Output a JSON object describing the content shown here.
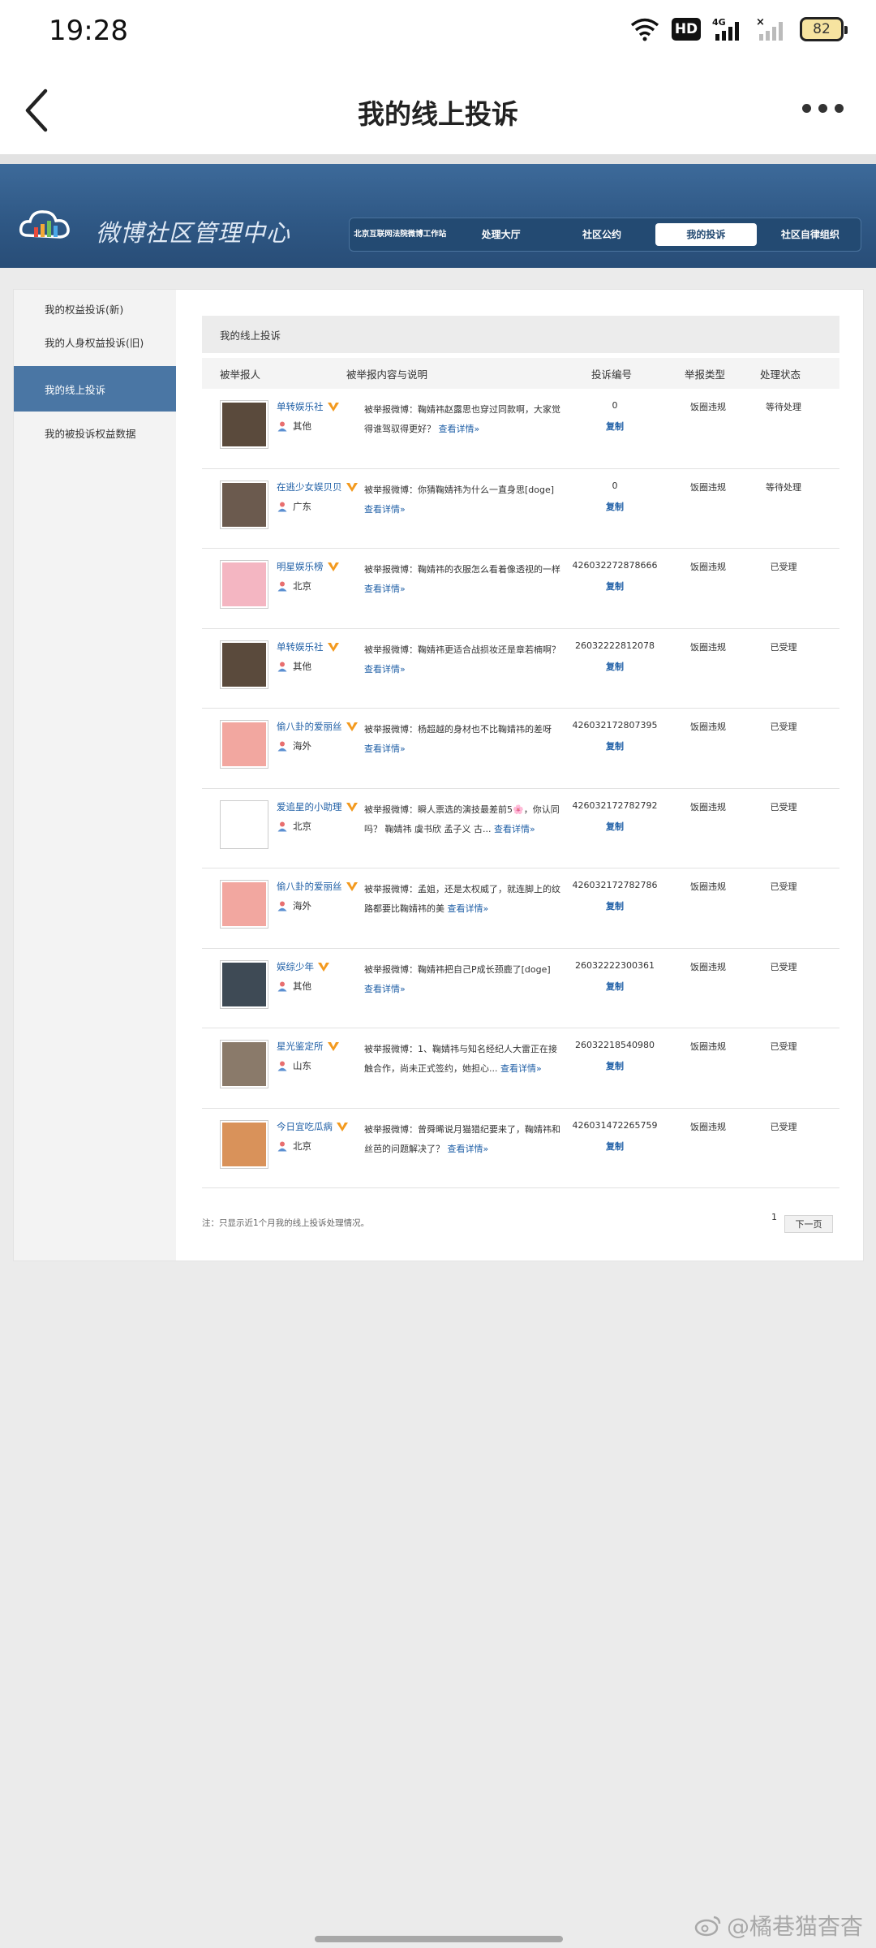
{
  "status_bar": {
    "time": "19:28",
    "hd_label": "HD",
    "network_label": "4G",
    "battery": "82",
    "icons": [
      "wifi-icon",
      "hd-icon",
      "signal-icon",
      "signal-muted-icon",
      "battery-icon"
    ]
  },
  "app_header": {
    "title": "我的线上投诉",
    "back_icon": "chevron-left-icon",
    "more_icon": "more-horizontal-icon"
  },
  "banner": {
    "title": "微博社区管理中心",
    "logo_icon": "cloud-logo-icon",
    "nav": [
      {
        "label": "北京互联网法院微博工作站",
        "active": false
      },
      {
        "label": "处理大厅",
        "active": false
      },
      {
        "label": "社区公约",
        "active": false
      },
      {
        "label": "我的投诉",
        "active": true
      },
      {
        "label": "社区自律组织",
        "active": false
      }
    ]
  },
  "sidebar": {
    "items": [
      {
        "label": "我的权益投诉(新)",
        "active": false
      },
      {
        "label": "我的人身权益投诉(旧)",
        "active": false
      },
      {
        "label": "我的线上投诉",
        "active": true
      },
      {
        "label": "我的被投诉权益数据",
        "active": false
      }
    ]
  },
  "content": {
    "title": "我的线上投诉",
    "columns": [
      "被举报人",
      "被举报内容与说明",
      "投诉编号",
      "举报类型",
      "处理状态"
    ],
    "copy_label": "复制",
    "more_label": "查看详情»",
    "rows": [
      {
        "name": "单转娱乐社",
        "region": "其他",
        "desc": "被举报微博：鞠婧祎赵露思也穿过同款啊，大家觉得谁驾驭得更好？",
        "id": "0",
        "type": "饭圈违规",
        "status": "等待处理",
        "avatar_color": "#5a4a3c"
      },
      {
        "name": "在逃少女娱贝贝",
        "region": "广东",
        "desc": "被举报微博：你猜鞠婧祎为什么一直身思[doge]",
        "id": "0",
        "type": "饭圈违规",
        "status": "等待处理",
        "avatar_color": "#6b5a4e"
      },
      {
        "name": "明星娱乐榜",
        "region": "北京",
        "desc": "被举报微博：鞠婧祎的衣服怎么看着像透视的一样",
        "id": "426032272878666",
        "type": "饭圈违规",
        "status": "已受理",
        "avatar_color": "#f4b6c2"
      },
      {
        "name": "单转娱乐社",
        "region": "其他",
        "desc": "被举报微博：鞠婧祎更适合战损妆还是章若楠啊？",
        "id": "26032222812078",
        "type": "饭圈违规",
        "status": "已受理",
        "avatar_color": "#5a4a3c"
      },
      {
        "name": "偷八卦的爱丽丝",
        "region": "海外",
        "desc": "被举报微博：杨超越的身材也不比鞠婧祎的差呀",
        "id": "426032172807395",
        "type": "饭圈违规",
        "status": "已受理",
        "avatar_color": "#f2a7a0"
      },
      {
        "name": "爱追星的小助理",
        "region": "北京",
        "desc": "被举报微博：瞬人票选的演技最差前5🌸，你认同吗？ 鞠婧祎 虞书欣 孟子义 古...",
        "id": "426032172782792",
        "type": "饭圈违规",
        "status": "已受理",
        "avatar_color": "#ffffff"
      },
      {
        "name": "偷八卦的爱丽丝",
        "region": "海外",
        "desc": "被举报微博：孟姐，还是太权威了，就连脚上的纹路都要比鞠婧祎的美",
        "id": "426032172782786",
        "type": "饭圈违规",
        "status": "已受理",
        "avatar_color": "#f2a7a0"
      },
      {
        "name": "娱综少年",
        "region": "其他",
        "desc": "被举报微博：鞠婧祎把自己P成长颈鹿了[doge]",
        "id": "26032222300361",
        "type": "饭圈违规",
        "status": "已受理",
        "avatar_color": "#3e4a55"
      },
      {
        "name": "星光鉴定所",
        "region": "山东",
        "desc": "被举报微博：1、鞠婧祎与知名经纪人大雷正在接触合作，尚未正式签约，她担心...",
        "id": "26032218540980",
        "type": "饭圈违规",
        "status": "已受理",
        "avatar_color": "#8a7a6a"
      },
      {
        "name": "今日宜吃瓜病",
        "region": "北京",
        "desc": "被举报微博：曾舜晞说月猫猎纪要来了，鞠婧祎和丝芭的问题解决了？",
        "id": "426031472265759",
        "type": "饭圈违规",
        "status": "已受理",
        "avatar_color": "#d9925a"
      }
    ],
    "footer_note": "注：只显示近1个月我的线上投诉处理情况。",
    "page_number": "1",
    "next_label": "下一页"
  },
  "watermark": {
    "text": "@橘巷猫杳杳",
    "icon": "weibo-icon"
  },
  "colors": {
    "banner": "#2f5885",
    "link": "#1f5fa6",
    "sidebar_active": "#4a76a4"
  }
}
